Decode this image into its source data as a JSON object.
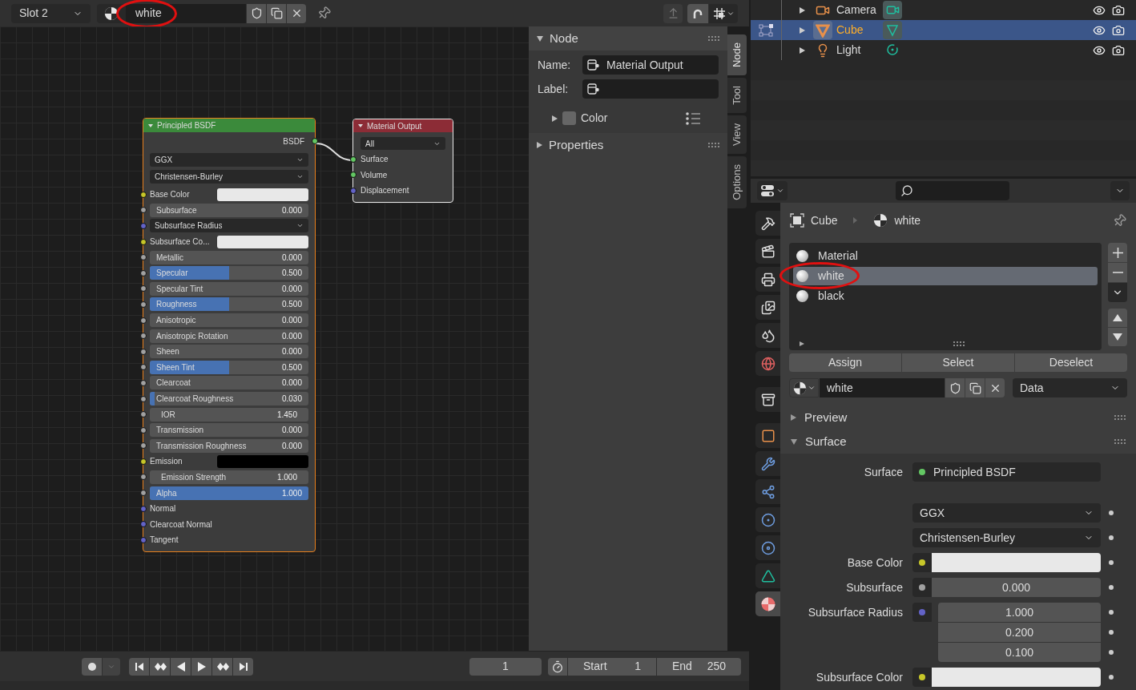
{
  "header": {
    "slot": "Slot 2",
    "material": "white",
    "material_circled": true
  },
  "nodes": {
    "principled": {
      "title": "Principled BSDF",
      "output": {
        "label": "BSDF",
        "color": "#63c763"
      },
      "dropdowns": [
        "GGX",
        "Christensen-Burley"
      ],
      "inputs": [
        {
          "kind": "color",
          "label": "Base Color",
          "color": "#c7c729",
          "swatch": {
            "color": "#e8e8e8"
          }
        },
        {
          "kind": "slider",
          "label": "Subsurface",
          "value": "0.000",
          "level": 0,
          "color": "#a1a1a1"
        },
        {
          "kind": "dropdown",
          "label": "Subsurface Radius",
          "color": "#6363c7"
        },
        {
          "kind": "color",
          "label": "Subsurface Co...",
          "color": "#c7c729",
          "swatch": {
            "color": "#e8e8e8"
          }
        },
        {
          "kind": "slider",
          "label": "Metallic",
          "value": "0.000",
          "level": 0,
          "color": "#a1a1a1"
        },
        {
          "kind": "slider",
          "label": "Specular",
          "value": "0.500",
          "level": 0.5,
          "color": "#a1a1a1"
        },
        {
          "kind": "slider",
          "label": "Specular Tint",
          "value": "0.000",
          "level": 0,
          "color": "#a1a1a1"
        },
        {
          "kind": "slider",
          "label": "Roughness",
          "value": "0.500",
          "level": 0.5,
          "color": "#a1a1a1"
        },
        {
          "kind": "slider",
          "label": "Anisotropic",
          "value": "0.000",
          "level": 0,
          "color": "#a1a1a1"
        },
        {
          "kind": "slider",
          "label": "Anisotropic Rotation",
          "value": "0.000",
          "level": 0,
          "color": "#a1a1a1"
        },
        {
          "kind": "slider",
          "label": "Sheen",
          "value": "0.000",
          "level": 0,
          "color": "#a1a1a1"
        },
        {
          "kind": "slider",
          "label": "Sheen Tint",
          "value": "0.500",
          "level": 0.5,
          "color": "#a1a1a1"
        },
        {
          "kind": "slider",
          "label": "Clearcoat",
          "value": "0.000",
          "level": 0,
          "color": "#a1a1a1"
        },
        {
          "kind": "slider",
          "label": "Clearcoat Roughness",
          "value": "0.030",
          "level": 0.03,
          "color": "#a1a1a1"
        },
        {
          "kind": "number",
          "label": "IOR",
          "value": "1.450",
          "color": "#a1a1a1"
        },
        {
          "kind": "slider",
          "label": "Transmission",
          "value": "0.000",
          "level": 0,
          "color": "#a1a1a1"
        },
        {
          "kind": "slider",
          "label": "Transmission Roughness",
          "value": "0.000",
          "level": 0,
          "color": "#a1a1a1"
        },
        {
          "kind": "color",
          "label": "Emission",
          "color": "#c7c729",
          "swatch": {
            "color": "#000000"
          }
        },
        {
          "kind": "number",
          "label": "Emission Strength",
          "value": "1.000",
          "color": "#a1a1a1"
        },
        {
          "kind": "slider",
          "label": "Alpha",
          "value": "1.000",
          "level": 1,
          "color": "#a1a1a1"
        },
        {
          "kind": "socket",
          "label": "Normal",
          "color": "#6363c7"
        },
        {
          "kind": "socket",
          "label": "Clearcoat Normal",
          "color": "#6363c7"
        },
        {
          "kind": "socket",
          "label": "Tangent",
          "color": "#6363c7"
        }
      ]
    },
    "output": {
      "title": "Material Output",
      "dropdown": "All",
      "inputs": [
        {
          "label": "Surface",
          "color": "#63c763"
        },
        {
          "label": "Volume",
          "color": "#63c763"
        },
        {
          "label": "Displacement",
          "color": "#6363c7"
        }
      ]
    }
  },
  "sidebar": {
    "panel": "Node",
    "name_label": "Name:",
    "name_value": "Material Output",
    "label_label": "Label:",
    "color_label": "Color",
    "properties": "Properties",
    "tabs": [
      {
        "label": "Node",
        "selected": true
      },
      {
        "label": "Tool",
        "selected": false
      },
      {
        "label": "View",
        "selected": false
      },
      {
        "label": "Options",
        "selected": false
      }
    ]
  },
  "timeline": {
    "frame": "1",
    "start_label": "Start",
    "start": "1",
    "end_label": "End",
    "end": "250"
  },
  "outliner": {
    "rows": [
      {
        "kind": "camera",
        "name": "Camera",
        "selected": false
      },
      {
        "kind": "mesh",
        "name": "Cube",
        "selected": true
      },
      {
        "kind": "light",
        "name": "Light",
        "selected": false
      }
    ]
  },
  "properties": {
    "breadcrumb": [
      "Cube",
      "white"
    ],
    "tabs": [
      {
        "kind": "tool",
        "selected": false
      },
      {
        "kind": "render",
        "selected": false
      },
      {
        "kind": "output",
        "selected": false
      },
      {
        "kind": "view_layer",
        "selected": false
      },
      {
        "kind": "scene",
        "selected": false
      },
      {
        "kind": "world",
        "selected": false
      },
      {
        "kind": "collection",
        "selected": false
      },
      {
        "kind": "object",
        "selected": false
      },
      {
        "kind": "modifier",
        "selected": false
      },
      {
        "kind": "particles",
        "selected": false
      },
      {
        "kind": "physics",
        "selected": false
      },
      {
        "kind": "constraints",
        "selected": false
      },
      {
        "kind": "data",
        "selected": false
      },
      {
        "kind": "material",
        "selected": true
      }
    ],
    "slots": [
      {
        "name": "Material",
        "selected": false,
        "circled": false
      },
      {
        "name": "white",
        "selected": true,
        "circled": true
      },
      {
        "name": "black",
        "selected": false,
        "circled": false
      }
    ],
    "buttons": [
      "Assign",
      "Select",
      "Deselect"
    ],
    "material": "white",
    "link": "Data",
    "panels": [
      {
        "title": "Preview",
        "expanded": false
      },
      {
        "title": "Surface",
        "expanded": true
      }
    ],
    "surface": {
      "label": "Surface",
      "shader": {
        "name": "Principled BSDF",
        "color": "#63c763"
      }
    },
    "fields": [
      {
        "kind": "dropdown",
        "value": "GGX"
      },
      {
        "kind": "dropdown",
        "value": "Christensen-Burley"
      },
      {
        "kind": "color",
        "label": "Base Color",
        "color": "#c7c729",
        "swatch": {
          "color": "#e8e8e8"
        }
      },
      {
        "kind": "number",
        "label": "Subsurface",
        "color": "#a1a1a1",
        "values": [
          "0.000"
        ]
      },
      {
        "kind": "vector",
        "label": "Subsurface Radius",
        "color": "#6363c7",
        "values": [
          "1.000",
          "0.200",
          "0.100"
        ]
      },
      {
        "kind": "color",
        "label": "Subsurface Color",
        "color": "#c7c729",
        "swatch": {
          "color": "#e8e8e8"
        }
      }
    ]
  }
}
